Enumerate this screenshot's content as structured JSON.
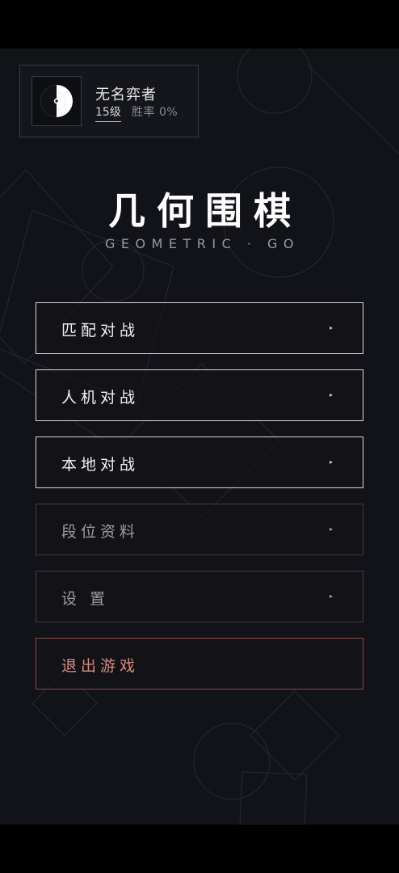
{
  "player": {
    "name": "无名弈者",
    "rank": "15级",
    "winrate": "胜率 0%",
    "avatar_icon": "yin-yang-stone-icon"
  },
  "title": "几何围棋",
  "subtitle": "GEOMETRIC · GO",
  "menu": {
    "match": "匹配对战",
    "ai": "人机对战",
    "local": "本地对战",
    "profile": "段位资料",
    "settings": "设 置",
    "exit": "退出游戏",
    "arrow": "▸"
  },
  "colors": {
    "background": "#121318",
    "accent_exit": "#d98a7e",
    "exit_border": "#8a4a46"
  }
}
